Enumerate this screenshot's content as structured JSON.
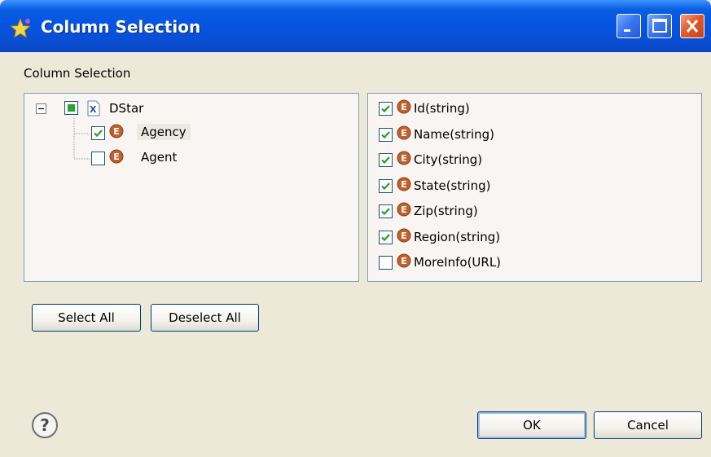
{
  "window": {
    "title": "Column Selection",
    "section_label": "Column Selection"
  },
  "tree": {
    "root": {
      "label": "DStar",
      "state": "partial"
    },
    "children": [
      {
        "label": "Agency",
        "checked": true,
        "selected": true
      },
      {
        "label": "Agent",
        "checked": false,
        "selected": false
      }
    ]
  },
  "columns": [
    {
      "label": "Id(string)",
      "checked": true
    },
    {
      "label": "Name(string)",
      "checked": true
    },
    {
      "label": "City(string)",
      "checked": true
    },
    {
      "label": "State(string)",
      "checked": true
    },
    {
      "label": "Zip(string)",
      "checked": true
    },
    {
      "label": "Region(string)",
      "checked": true
    },
    {
      "label": "MoreInfo(URL)",
      "checked": false
    }
  ],
  "buttons": {
    "select_all": "Select All",
    "deselect_all": "Deselect All",
    "ok": "OK",
    "cancel": "Cancel"
  },
  "icons": {
    "title": "star-icon",
    "help": "help-icon",
    "entity": "entity-e-icon",
    "xml": "xml-file-icon"
  },
  "colors": {
    "titlebar": "#0554e3",
    "dialog_bg": "#ece9d8",
    "panel_bg": "#f8f5f2",
    "check": "#21a121",
    "entity_icon": "#c0612b"
  }
}
